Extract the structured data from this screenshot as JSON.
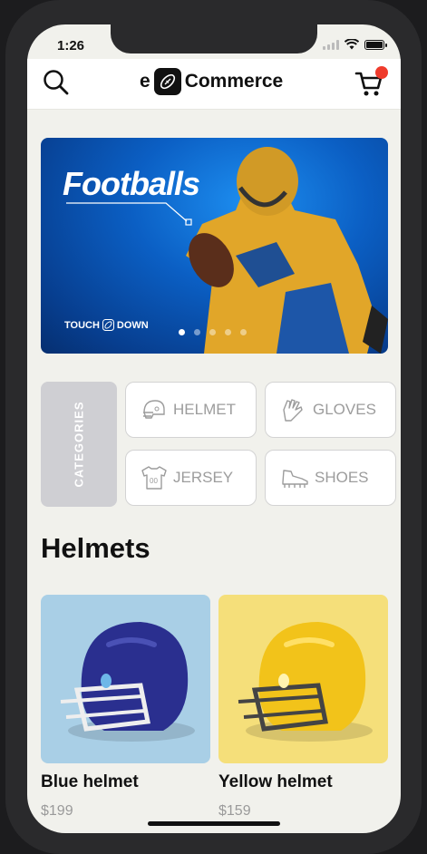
{
  "status": {
    "time": "1:26"
  },
  "header": {
    "brand_prefix": "e",
    "brand_name": "Commerce",
    "icons": [
      "search-icon",
      "football-logo-icon",
      "cart-icon"
    ]
  },
  "banner": {
    "title": "Footballs",
    "tag_left": "TOUCH",
    "tag_right": "DOWN",
    "slide_count": 5,
    "active_slide": 1
  },
  "categories": {
    "label": "CATEGORIES",
    "items": [
      {
        "label": "HELMET",
        "icon": "helmet-icon"
      },
      {
        "label": "GLOVES",
        "icon": "gloves-icon"
      },
      {
        "label": "JERSEY",
        "icon": "jersey-icon"
      },
      {
        "label": "SHOES",
        "icon": "shoes-icon"
      }
    ]
  },
  "section": {
    "title": "Helmets"
  },
  "products": [
    {
      "name": "Blue helmet",
      "price": "$199",
      "bg_color": "#a9cfe6",
      "helmet_color": "#2a2f8f"
    },
    {
      "name": "Yellow helmet",
      "price": "$159",
      "bg_color": "#f5df7a",
      "helmet_color": "#f2c31a"
    }
  ],
  "colors": {
    "accent_dot": "#ef3b2c",
    "banner_blue": "#0b5fc4"
  }
}
